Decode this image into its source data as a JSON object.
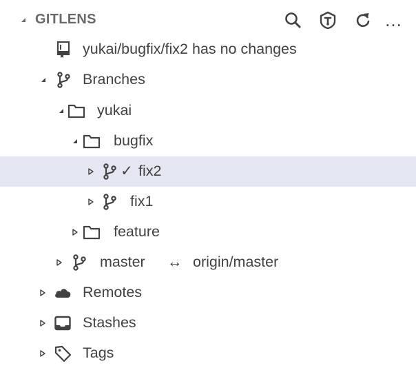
{
  "section": {
    "title": "GITLENS",
    "actions": [
      {
        "name": "search-icon"
      },
      {
        "name": "gitlens-icon"
      },
      {
        "name": "refresh-icon"
      },
      {
        "name": "more-icon",
        "glyph": "…"
      }
    ]
  },
  "repo_status": {
    "label": "yukai/bugfix/fix2 has no changes",
    "icon": "repository-icon"
  },
  "branches": {
    "label": "Branches",
    "folders": {
      "yukai": {
        "label": "yukai"
      },
      "bugfix": {
        "label": "bugfix"
      },
      "feature": {
        "label": "feature"
      }
    },
    "items": {
      "fix2": {
        "label": "fix2",
        "current_mark": "✓",
        "selected": true
      },
      "fix1": {
        "label": "fix1"
      },
      "master": {
        "label": "master",
        "tracking_glyph": "↔",
        "upstream": "origin/master"
      }
    }
  },
  "remotes": {
    "label": "Remotes",
    "icon": "cloud-icon"
  },
  "stashes": {
    "label": "Stashes",
    "icon": "inbox-icon"
  },
  "tags": {
    "label": "Tags",
    "icon": "tag-icon"
  },
  "colors": {
    "text": "#424242",
    "header_text": "#6a6a6a",
    "selected_row": "#e4e6f1",
    "background": "#ffffff"
  }
}
